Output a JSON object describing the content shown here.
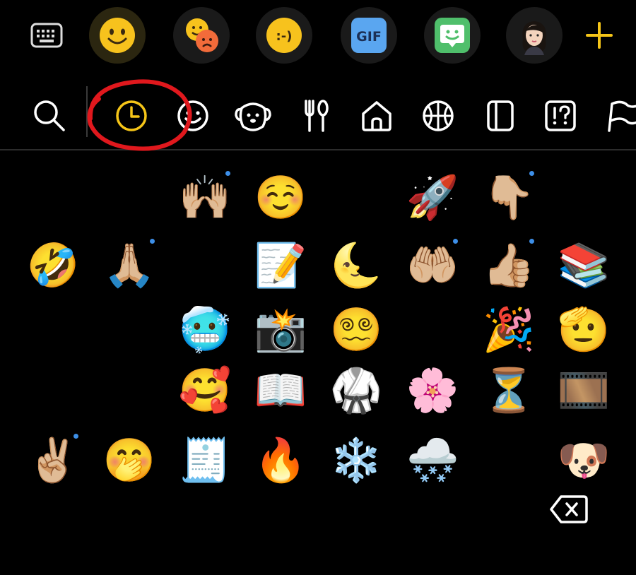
{
  "top_tabs": [
    {
      "name": "keyboard-icon",
      "active": false
    },
    {
      "name": "emoji-tab-icon",
      "active": true
    },
    {
      "name": "sticker-tab-icon",
      "active": false
    },
    {
      "name": "emoticon-tab-icon",
      "label": ":-)",
      "active": false
    },
    {
      "name": "gif-tab-icon",
      "label": "GIF",
      "active": false
    },
    {
      "name": "bitmoji-tab-icon",
      "active": false
    },
    {
      "name": "avatar-tab-icon",
      "active": false
    },
    {
      "name": "add-icon",
      "active": false
    }
  ],
  "categories": [
    {
      "name": "search-icon"
    },
    {
      "name": "recent-icon",
      "selected": true
    },
    {
      "name": "smileys-icon"
    },
    {
      "name": "animals-icon"
    },
    {
      "name": "food-icon"
    },
    {
      "name": "travel-icon"
    },
    {
      "name": "activities-icon"
    },
    {
      "name": "objects-icon"
    },
    {
      "name": "symbols-icon"
    },
    {
      "name": "flags-icon"
    }
  ],
  "colors": {
    "accent": "#f5c518",
    "annotation": "#e0181d",
    "badge": "#3d8fe8"
  },
  "emoji_rows": [
    [
      {
        "e": "😃"
      },
      {
        "e": "😂"
      },
      {
        "e": "🙌🏼",
        "dot": true
      },
      {
        "e": "☺️"
      },
      {
        "e": "😍"
      },
      {
        "e": "🚀"
      },
      {
        "e": "👇🏼",
        "dot": true
      },
      {
        "e": "😅"
      }
    ],
    [
      {
        "e": "🤣"
      },
      {
        "e": "🙏🏼",
        "dot": true
      },
      {
        "e": "😀"
      },
      {
        "e": "📝"
      },
      {
        "e": "🌜"
      },
      {
        "e": "🤲🏼",
        "dot": true
      },
      {
        "e": "👍🏼",
        "dot": true
      },
      {
        "e": "📚"
      }
    ],
    [
      {
        "e": "😱"
      },
      {
        "e": "😄"
      },
      {
        "e": "🥶"
      },
      {
        "e": "📸"
      },
      {
        "e": "😵‍💫"
      },
      {
        "e": "😊"
      },
      {
        "e": "🎉"
      },
      {
        "e": "🫡"
      }
    ],
    [
      {
        "e": "😁"
      },
      {
        "e": "😆"
      },
      {
        "e": "🥰"
      },
      {
        "e": "📖"
      },
      {
        "e": "🥋"
      },
      {
        "e": "🌸"
      },
      {
        "e": "⏳"
      },
      {
        "e": "🎞️"
      }
    ],
    [
      {
        "e": "✌🏼",
        "dot": true
      },
      {
        "e": "🤭"
      },
      {
        "e": "🧾"
      },
      {
        "e": "🔥"
      },
      {
        "e": "❄️"
      },
      {
        "e": "🌨️"
      },
      {
        "e": "😮"
      },
      {
        "e": "🐶"
      }
    ]
  ]
}
